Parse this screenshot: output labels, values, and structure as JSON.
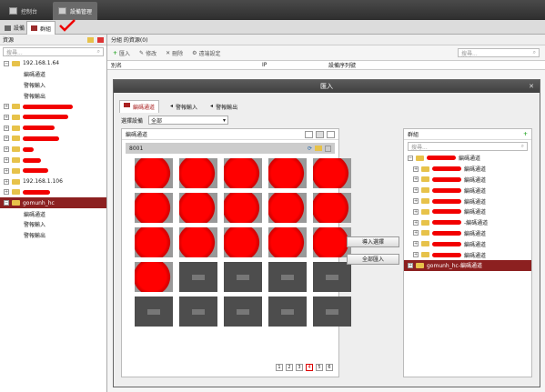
{
  "topbar": {
    "tabs": [
      "控制台",
      "設備管理"
    ]
  },
  "subbar": {
    "tabs": [
      "設備",
      "群組"
    ]
  },
  "left": {
    "header": "資源",
    "search_placeholder": "搜尋...",
    "tree": [
      {
        "type": "group",
        "label": "192.168.1.64",
        "expanded": true
      },
      {
        "type": "leaf",
        "label": "編碼通道"
      },
      {
        "type": "leaf",
        "label": "警報輸入"
      },
      {
        "type": "leaf",
        "label": "警報輸出"
      },
      {
        "type": "group",
        "label": "",
        "redacted": 55
      },
      {
        "type": "group",
        "label": "",
        "redacted": 50
      },
      {
        "type": "group",
        "label": "",
        "redacted": 35
      },
      {
        "type": "group",
        "label": "",
        "redacted": 40
      },
      {
        "type": "group",
        "label": "",
        "redacted": 12
      },
      {
        "type": "group",
        "label": "",
        "redacted": 20
      },
      {
        "type": "group",
        "label": "",
        "redacted": 28
      },
      {
        "type": "group",
        "label": "192.168.1.106"
      },
      {
        "type": "group",
        "label": "",
        "redacted": 30
      },
      {
        "type": "group",
        "label": "gomunh_hc",
        "selected": true,
        "expanded": true
      },
      {
        "type": "leaf",
        "label": "編碼通道"
      },
      {
        "type": "leaf",
        "label": "警報輸入"
      },
      {
        "type": "leaf",
        "label": "警報輸出"
      }
    ]
  },
  "main": {
    "header": "分組 的資源(0)",
    "toolbar": {
      "import": "匯入",
      "modify": "修改",
      "delete": "刪除",
      "remote": "遠端設定"
    },
    "search_placeholder": "搜尋...",
    "columns": [
      "別名",
      "IP",
      "設備序列號"
    ]
  },
  "dialog": {
    "title": "匯入",
    "tabs": [
      "編碼通道",
      "警報輸入",
      "警報輸出"
    ],
    "select_label": "選擇設備",
    "select_value": "全部",
    "channels_label": "編碼通道",
    "device_id": "8001",
    "import_selected": "導入選擇",
    "import_all": "全部匯入",
    "pages": [
      "1",
      "2",
      "3",
      "4",
      "5",
      "6"
    ],
    "current_page": "4",
    "groups_label": "群組",
    "groups_search": "搜尋...",
    "groups": [
      {
        "label": "編碼通道",
        "level": 1
      },
      {
        "label": "編碼通道",
        "level": 2
      },
      {
        "label": "編碼通道",
        "level": 2
      },
      {
        "label": "編碼通道",
        "level": 2
      },
      {
        "label": "編碼通道",
        "level": 2
      },
      {
        "label": "編碼通道",
        "level": 2
      },
      {
        "label": "-編碼通道",
        "level": 2
      },
      {
        "label": "編碼通道",
        "level": 2
      },
      {
        "label": "編碼通道",
        "level": 2
      },
      {
        "label": "編碼通道",
        "level": 2
      },
      {
        "label": "gomunh_hc-編碼通道",
        "level": 1,
        "selected": true
      }
    ]
  },
  "colors": {
    "accent": "#8c2020",
    "redaction": "#f20000"
  }
}
